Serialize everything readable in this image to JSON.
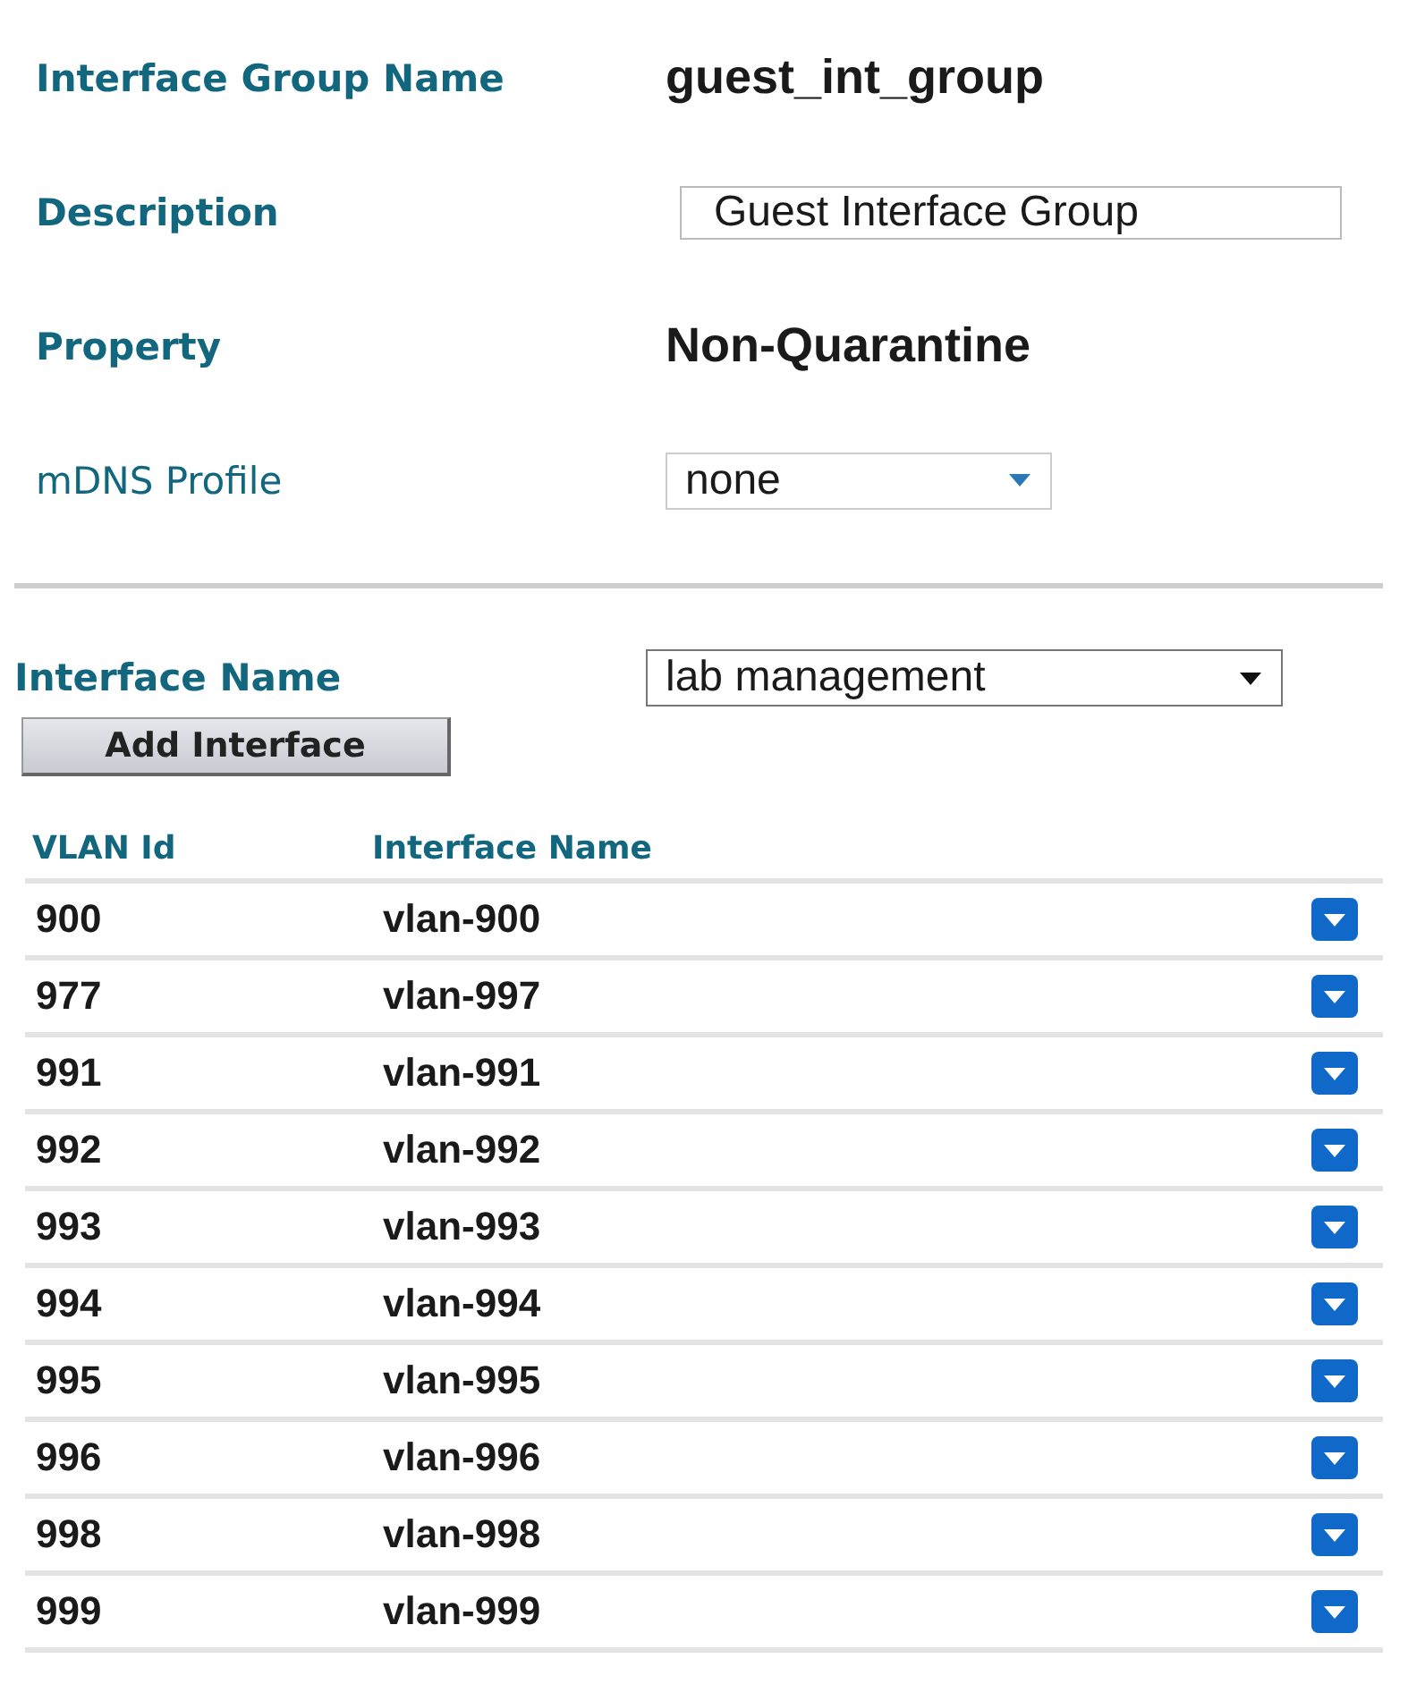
{
  "group_form": {
    "fields": [
      {
        "kind": "text",
        "label": "Interface Group Name",
        "value": "guest_int_group"
      },
      {
        "kind": "input",
        "label": "Description",
        "value": "Guest Interface Group"
      },
      {
        "kind": "text",
        "label": "Property",
        "value": "Non-Quarantine"
      },
      {
        "kind": "select",
        "label": "mDNS Profile",
        "value": "none"
      }
    ]
  },
  "interface_picker": {
    "label": "Interface Name",
    "value": "lab management",
    "button": "Add Interface"
  },
  "table": {
    "columns": [
      "VLAN Id",
      "Interface Name"
    ],
    "rows": [
      {
        "vlan_id": "900",
        "interface": "vlan-900"
      },
      {
        "vlan_id": "977",
        "interface": "vlan-997"
      },
      {
        "vlan_id": "991",
        "interface": "vlan-991"
      },
      {
        "vlan_id": "992",
        "interface": "vlan-992"
      },
      {
        "vlan_id": "993",
        "interface": "vlan-993"
      },
      {
        "vlan_id": "994",
        "interface": "vlan-994"
      },
      {
        "vlan_id": "995",
        "interface": "vlan-995"
      },
      {
        "vlan_id": "996",
        "interface": "vlan-996"
      },
      {
        "vlan_id": "998",
        "interface": "vlan-998"
      },
      {
        "vlan_id": "999",
        "interface": "vlan-999"
      }
    ]
  }
}
